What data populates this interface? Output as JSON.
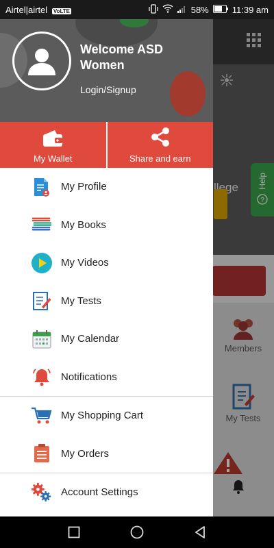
{
  "status_bar": {
    "carrier": "Airtel|airtel",
    "network_badge": "VoLTE",
    "battery": "58%",
    "time": "11:39 am",
    "icons": [
      "vibrate-icon",
      "wifi-icon",
      "signal-icon",
      "battery-icon"
    ]
  },
  "background_app": {
    "banner_word": "llege",
    "help_label": "Help",
    "tiles": [
      "Members",
      "My Tests"
    ]
  },
  "drawer": {
    "welcome_line1": "Welcome ASD",
    "welcome_line2": "Women",
    "login_label": "Login/Signup",
    "actions": [
      {
        "label": "My Wallet",
        "icon": "wallet-icon"
      },
      {
        "label": "Share and earn",
        "icon": "share-icon"
      }
    ],
    "menu_group1": [
      {
        "label": "My Profile",
        "icon": "profile-document-icon"
      },
      {
        "label": "My Books",
        "icon": "books-icon"
      },
      {
        "label": "My Videos",
        "icon": "play-video-icon"
      },
      {
        "label": "My Tests",
        "icon": "test-pencil-icon"
      },
      {
        "label": "My Calendar",
        "icon": "calendar-icon"
      },
      {
        "label": "Notifications",
        "icon": "bell-icon"
      }
    ],
    "menu_group2": [
      {
        "label": "My Shopping Cart",
        "icon": "shopping-cart-icon"
      },
      {
        "label": "My Orders",
        "icon": "orders-list-icon"
      }
    ],
    "menu_group3": [
      {
        "label": "Account Settings",
        "icon": "gears-icon"
      }
    ]
  },
  "colors": {
    "accent": "#e04a3c",
    "status_bar": "#1a1a1a",
    "help_green": "#3aa04a"
  },
  "nav_bar": {
    "buttons": [
      "recents-square-icon",
      "home-circle-icon",
      "back-triangle-icon"
    ]
  }
}
